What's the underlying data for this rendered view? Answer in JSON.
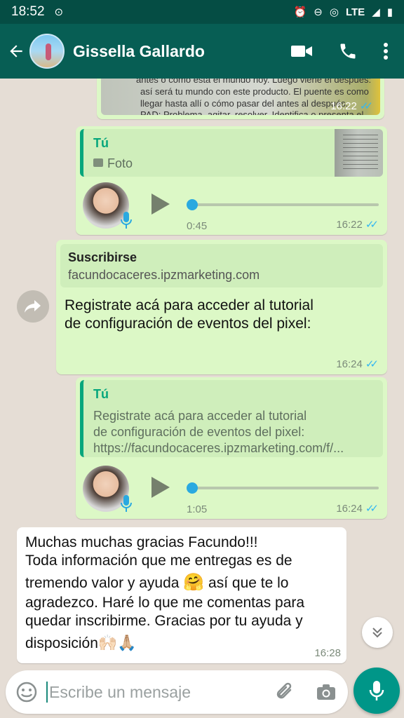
{
  "status_bar": {
    "time": "18:52",
    "network": "LTE"
  },
  "header": {
    "contact_name": "Gissella Gallardo"
  },
  "messages": {
    "photo": {
      "text_lines": [
        "antes o cómo está el mundo hoy. Luego viene el después:",
        "así será tu mundo con este producto. El puente es como",
        "llegar hasta allí o cómo pasar del antes al después.",
        "PAD: Problema, agitar, resolver. Identifica o presenta el"
      ],
      "time": "16:22"
    },
    "voice1": {
      "quote_author": "Tú",
      "quote_label": "Foto",
      "duration": "0:45",
      "time": "16:22",
      "progress": 0
    },
    "forwarded": {
      "link_title": "Suscribirse",
      "link_domain": "facundocaceres.ipzmarketing.com",
      "text_line1": "Registrate acá para acceder al tutorial",
      "text_line2": "de configuración de eventos del pixel:",
      "time": "16:24"
    },
    "voice2": {
      "quote_author": "Tú",
      "quote_line1": "Registrate acá para acceder al tutorial",
      "quote_line2": "de configuración de eventos del pixel:",
      "quote_line3": "https://facundocaceres.ipzmarketing.com/f/...",
      "duration": "1:05",
      "time": "16:24",
      "progress": 0
    },
    "incoming": {
      "line1": "Muchas muchas gracias Facundo!!!",
      "line2": "Toda información que me entregas es de",
      "line3a": "tremendo valor y ayuda",
      "line3_emoji": "🤗",
      "line3b": "así que te lo",
      "line4": "agradezco. Haré lo que me comentas para",
      "line5": "quedar inscribirme. Gracias por tu ayuda y",
      "line6": "disposición",
      "line6_emoji": "🙌🏻🙏🏼",
      "time": "16:28"
    }
  },
  "input": {
    "placeholder": "Escribe un mensaje"
  },
  "colors": {
    "header": "#075e54",
    "status_bar": "#054d44",
    "outgoing": "#dcf8c6",
    "incoming": "#ffffff",
    "accent": "#009688",
    "ticks": "#34b7f1"
  }
}
